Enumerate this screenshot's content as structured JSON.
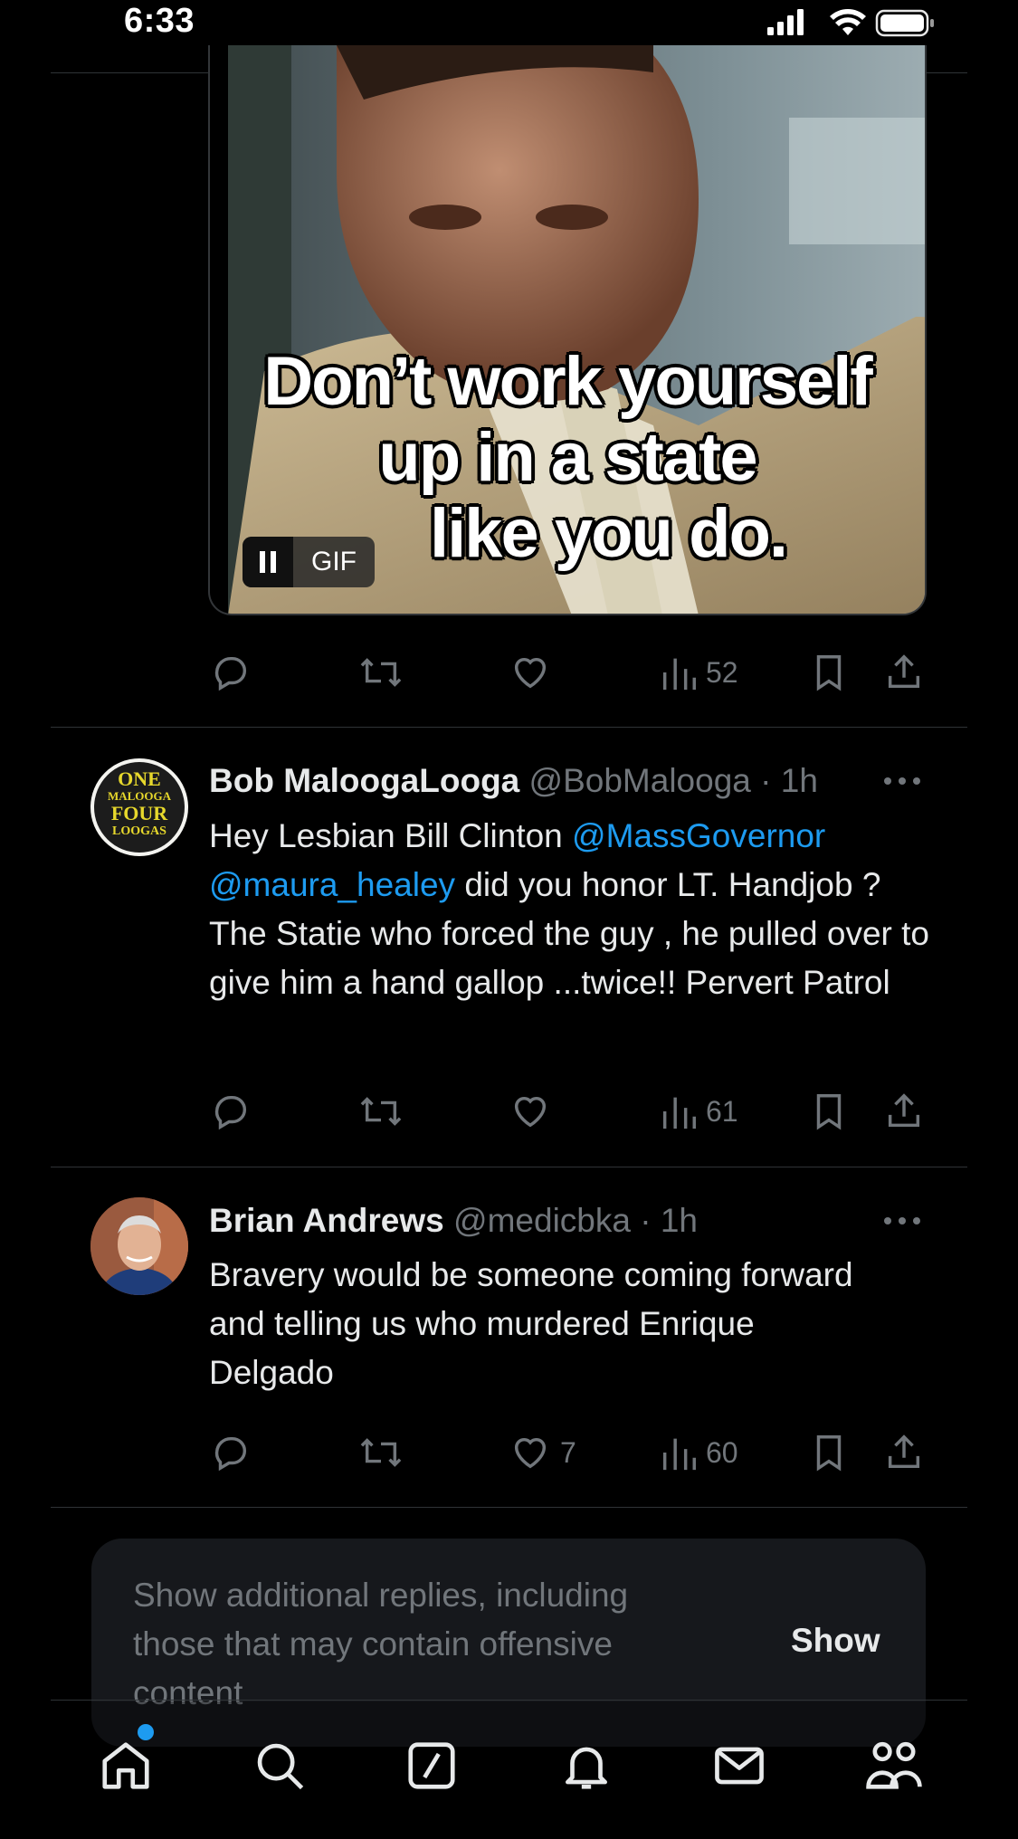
{
  "status_bar": {
    "time": "6:33"
  },
  "media": {
    "caption_lines": [
      "Don’t work yourself",
      "up in a state",
      "like you do."
    ],
    "gif_label": "GIF"
  },
  "tweets": [
    {
      "views": "52"
    },
    {
      "name": "Bob MaloogaLooga",
      "handle": "@BobMalooga",
      "time": "· 1h",
      "avatar_text": [
        "ONE",
        "MALOOGA",
        "FOUR",
        "LOOGAS"
      ],
      "body": {
        "t1": "Hey Lesbian Bill Clinton ",
        "m1": "@MassGovernor",
        "m2": "@maura_healey",
        "t2": " did you honor LT. Handjob ? The Statie who forced the guy , he pulled over to give him a hand gallop ...twice!! Pervert Patrol"
      },
      "views": "61"
    },
    {
      "name": "Brian Andrews",
      "handle": "@medicbka",
      "time": "· 1h",
      "body": "Bravery would be someone coming forward and telling us who murdered Enrique Delgado",
      "likes": "7",
      "views": "60"
    }
  ],
  "show_more": {
    "text": "Show additional replies, including those that may contain offensive content",
    "button": "Show"
  },
  "nav": [
    "home-icon",
    "search-icon",
    "grok-icon",
    "notifications-icon",
    "messages-icon",
    "communities-icon"
  ],
  "colors": {
    "accent": "#1d9bf0",
    "text": "#e7e9ea",
    "muted": "#71767b",
    "background": "#000000"
  }
}
